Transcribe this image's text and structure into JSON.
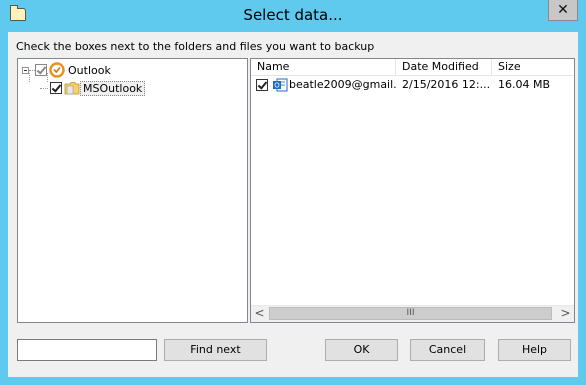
{
  "window": {
    "title": "Select data...",
    "close_glyph": "✕"
  },
  "instructions": "Check the boxes next to the folders and files you want to backup",
  "tree": [
    {
      "label": "Outlook",
      "icon": "outlook-icon",
      "checked": true
    },
    {
      "label": "MSOutlook",
      "icon": "folder-icon",
      "checked": true,
      "selected": true
    }
  ],
  "list": {
    "columns": [
      "Name",
      "Date Modified",
      "Size"
    ],
    "rows": [
      {
        "name": "beatle2009@gmail....",
        "date_modified": "2/15/2016 12:...",
        "size": "16.04 MB",
        "checked": true,
        "icon": "outlook-pst-icon"
      }
    ],
    "scrollbar": {
      "left_arrow": "<",
      "right_arrow": ">",
      "thumb_grip": "III"
    }
  },
  "search": {
    "value": "",
    "placeholder": ""
  },
  "buttons": {
    "find_next": "Find next",
    "ok": "OK",
    "cancel": "Cancel",
    "help": "Help"
  },
  "colors": {
    "title_bar": "#5fc9ee",
    "dialog_bg": "#f0f0f0",
    "outlook_orange": "#e8911e",
    "outlook_blue": "#1c6cc1"
  }
}
